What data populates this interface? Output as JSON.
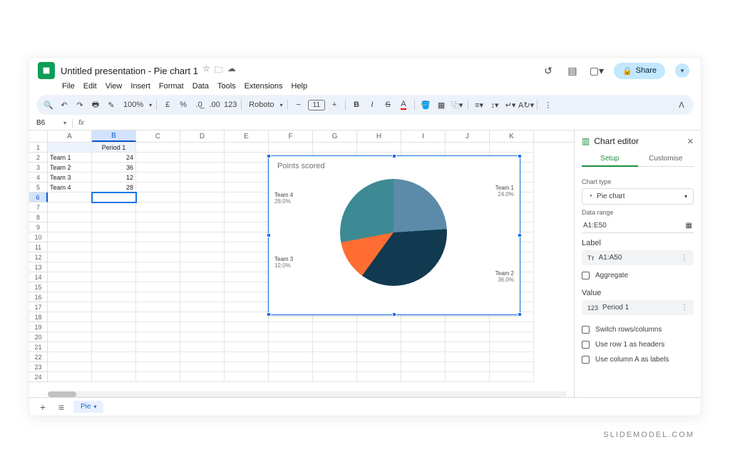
{
  "app": {
    "title": "Untitled presentation - Pie chart 1",
    "share": "Share",
    "menus": [
      "File",
      "Edit",
      "View",
      "Insert",
      "Format",
      "Data",
      "Tools",
      "Extensions",
      "Help"
    ]
  },
  "toolbar": {
    "zoom": "100%",
    "currency": "£",
    "percent": "%",
    "font": "Roboto",
    "size": "11"
  },
  "fx": {
    "cell": "B6",
    "formula": ""
  },
  "grid": {
    "cols": [
      "A",
      "B",
      "C",
      "D",
      "E",
      "F",
      "G",
      "H",
      "I",
      "J",
      "K"
    ],
    "rows": [
      1,
      2,
      3,
      4,
      5,
      6,
      7,
      8,
      9,
      10,
      11,
      12,
      13,
      14,
      15,
      16,
      17,
      18,
      19,
      20,
      21,
      22,
      23,
      24
    ],
    "header_b1": "Period 1",
    "data": [
      {
        "a": "Team 1",
        "b": "24"
      },
      {
        "a": "Team 2",
        "b": "36"
      },
      {
        "a": "Team 3",
        "b": "12"
      },
      {
        "a": "Team 4",
        "b": "28"
      }
    ],
    "active": "B6"
  },
  "chart_data": {
    "type": "pie",
    "title": "Points scored",
    "categories": [
      "Team 1",
      "Team 2",
      "Team 3",
      "Team 4"
    ],
    "values": [
      24,
      36,
      12,
      28
    ],
    "percents": [
      "24.0%",
      "36.0%",
      "12.0%",
      "28.0%"
    ],
    "colors": [
      "#5b8ba8",
      "#11394f",
      "#ff6d33",
      "#3d8a94"
    ]
  },
  "editor": {
    "title": "Chart editor",
    "tabs": {
      "setup": "Setup",
      "customise": "Customise"
    },
    "chart_type_label": "Chart type",
    "chart_type": "Pie chart",
    "data_range_label": "Data range",
    "data_range": "A1:E50",
    "label_heading": "Label",
    "label_value": "A1:A50",
    "aggregate": "Aggregate",
    "value_heading": "Value",
    "value_value": "Period 1",
    "opt1": "Switch rows/columns",
    "opt2": "Use row 1 as headers",
    "opt3": "Use column A as labels"
  },
  "tabs": {
    "sheet": "Pie"
  },
  "watermark": "SLIDEMODEL.COM"
}
